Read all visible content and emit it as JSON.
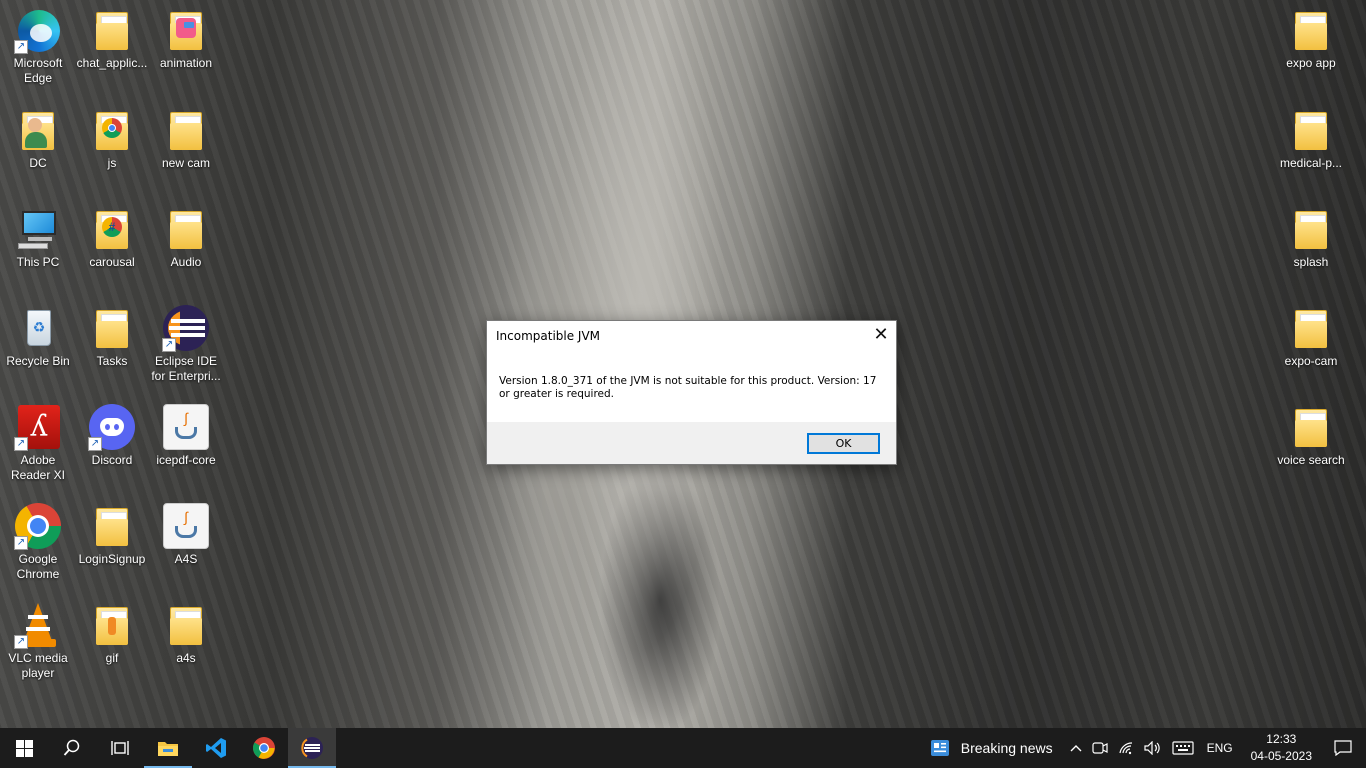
{
  "desktop": {
    "icons": [
      {
        "label": "Microsoft Edge",
        "icon": "edge-icon"
      },
      {
        "label": "chat_applic...",
        "icon": "folder-icon"
      },
      {
        "label": "animation",
        "icon": "folder-icon"
      },
      {
        "label": "DC",
        "icon": "user-folder-icon"
      },
      {
        "label": "js",
        "icon": "folder-icon"
      },
      {
        "label": "new cam",
        "icon": "folder-icon"
      },
      {
        "label": "This PC",
        "icon": "computer-icon"
      },
      {
        "label": "carousal",
        "icon": "folder-icon"
      },
      {
        "label": "Audio",
        "icon": "folder-icon"
      },
      {
        "label": "Recycle Bin",
        "icon": "recycle-bin-icon"
      },
      {
        "label": "Tasks",
        "icon": "folder-icon"
      },
      {
        "label": "Eclipse IDE for Enterpri...",
        "icon": "eclipse-icon"
      },
      {
        "label": "Adobe Reader XI",
        "icon": "adobe-reader-icon"
      },
      {
        "label": "Discord",
        "icon": "discord-icon"
      },
      {
        "label": "icepdf-core",
        "icon": "java-icon"
      },
      {
        "label": "Google Chrome",
        "icon": "chrome-icon"
      },
      {
        "label": "LoginSignup",
        "icon": "folder-icon"
      },
      {
        "label": "A4S",
        "icon": "java-icon"
      },
      {
        "label": "VLC media player",
        "icon": "vlc-icon"
      },
      {
        "label": "gif",
        "icon": "folder-icon"
      },
      {
        "label": "a4s",
        "icon": "folder-icon"
      },
      {
        "label": "expo app",
        "icon": "folder-icon"
      },
      {
        "label": "medical-p...",
        "icon": "folder-icon"
      },
      {
        "label": "splash",
        "icon": "folder-icon"
      },
      {
        "label": "expo-cam",
        "icon": "folder-icon"
      },
      {
        "label": "voice search",
        "icon": "folder-icon"
      }
    ]
  },
  "dialog": {
    "title": "Incompatible JVM",
    "close": "✕",
    "message": "Version 1.8.0_371 of the JVM is not suitable for this product. Version: 17 or greater is required.",
    "ok_label": "OK"
  },
  "taskbar": {
    "news_label": "Breaking news",
    "language": "ENG",
    "time": "12:33",
    "date": "04-05-2023"
  }
}
